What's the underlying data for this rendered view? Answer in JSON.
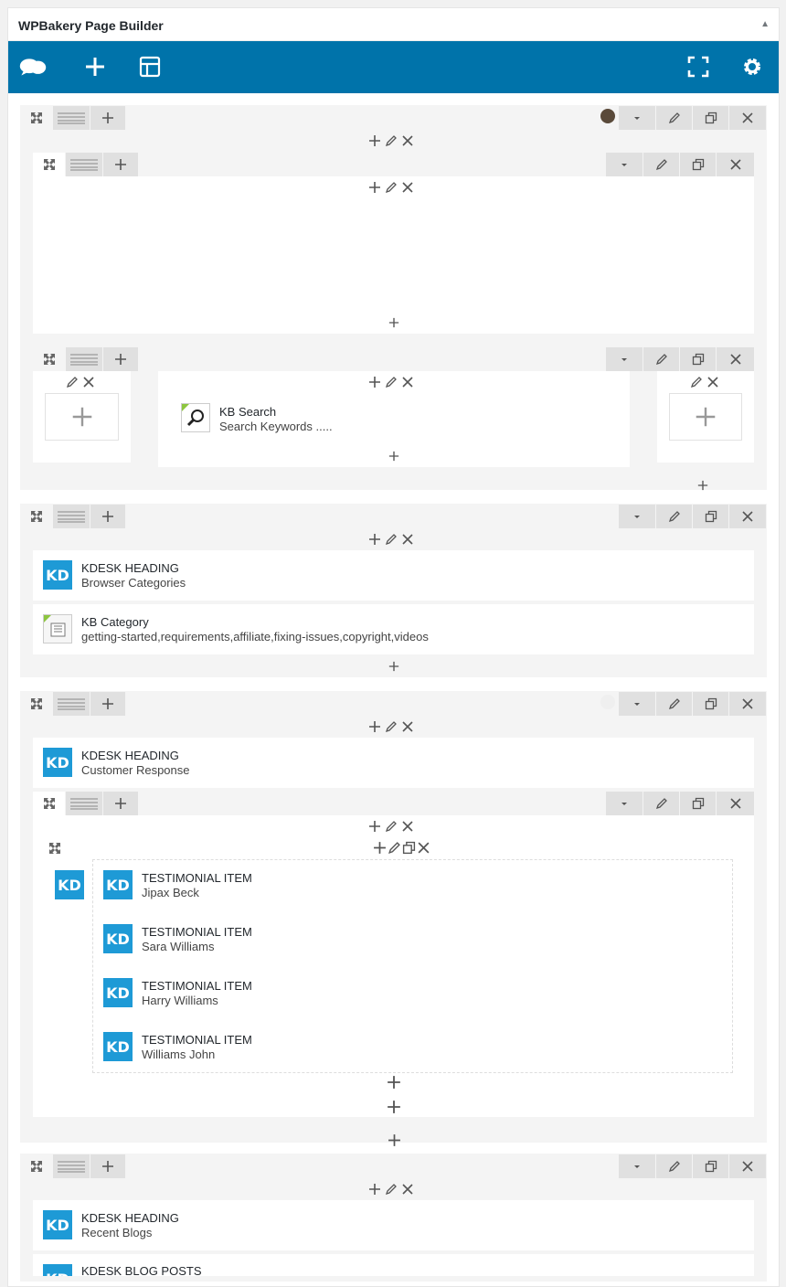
{
  "panel": {
    "title": "WPBakery Page Builder"
  },
  "toolbar": {
    "logo": "wpbakery-logo-icon",
    "add": "plus-icon",
    "templates": "layout-icon",
    "fullscreen": "fullscreen-icon",
    "settings": "gear-icon"
  },
  "elements": {
    "kb_search": {
      "title": "KB Search",
      "sub": "Search Keywords ....."
    },
    "heading1": {
      "title": "KDESK HEADING",
      "sub": "Browser Categories"
    },
    "kb_category": {
      "title": "KB Category",
      "sub": "getting-started,requirements,affiliate,fixing-issues,copyright,videos"
    },
    "heading2": {
      "title": "KDESK HEADING",
      "sub": "Customer Response"
    },
    "testimonials": [
      {
        "title": "TESTIMONIAL ITEM",
        "sub": "Jipax Beck"
      },
      {
        "title": "TESTIMONIAL ITEM",
        "sub": "Sara Williams"
      },
      {
        "title": "TESTIMONIAL ITEM",
        "sub": "Harry Williams"
      },
      {
        "title": "TESTIMONIAL ITEM",
        "sub": "Williams John"
      }
    ],
    "heading3": {
      "title": "KDESK HEADING",
      "sub": "Recent Blogs"
    },
    "blog": {
      "title": "KDESK BLOG POSTS"
    }
  },
  "kd_label": "KD",
  "colors": {
    "toolbar": "#0073aa",
    "kd": "#1e9ad6"
  }
}
